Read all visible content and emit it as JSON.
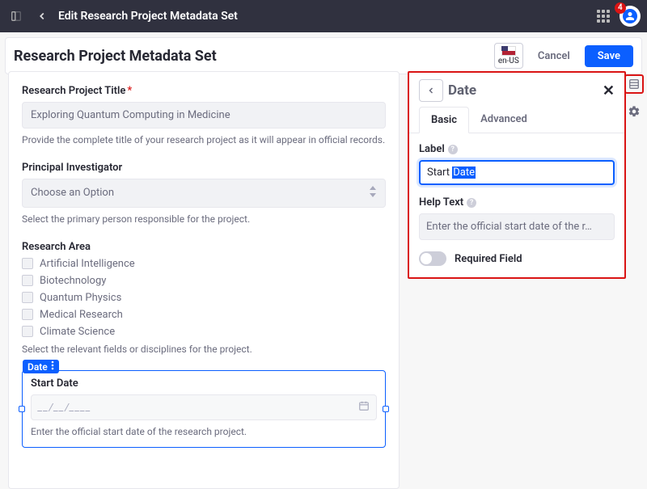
{
  "topbar": {
    "title": "Edit Research Project Metadata Set",
    "notif_count": "4"
  },
  "header": {
    "title": "Research Project Metadata Set",
    "locale": "en-US",
    "cancel_label": "Cancel",
    "save_label": "Save"
  },
  "canvas": {
    "title_field": {
      "label": "Research Project Title",
      "value": "Exploring Quantum Computing in Medicine",
      "help": "Provide the complete title of your research project as it will appear in official records."
    },
    "pi_field": {
      "label": "Principal Investigator",
      "placeholder": "Choose an Option",
      "help": "Select the primary person responsible for the project."
    },
    "area_field": {
      "label": "Research Area",
      "options": [
        "Artificial Intelligence",
        "Biotechnology",
        "Quantum Physics",
        "Medical Research",
        "Climate Science"
      ],
      "help": "Select the relevant fields or disciplines for the project."
    },
    "date_field": {
      "type_tag": "Date",
      "label": "Start Date",
      "placeholder": "__/__/____",
      "help": "Enter the official start date of the research project."
    }
  },
  "panel": {
    "title": "Date",
    "tabs": {
      "basic": "Basic",
      "advanced": "Advanced"
    },
    "label_field": {
      "label": "Label",
      "prefix": "Start ",
      "selected": "Date"
    },
    "help_field": {
      "label": "Help Text",
      "value": "Enter the official start date of the r…"
    },
    "required_label": "Required Field"
  }
}
